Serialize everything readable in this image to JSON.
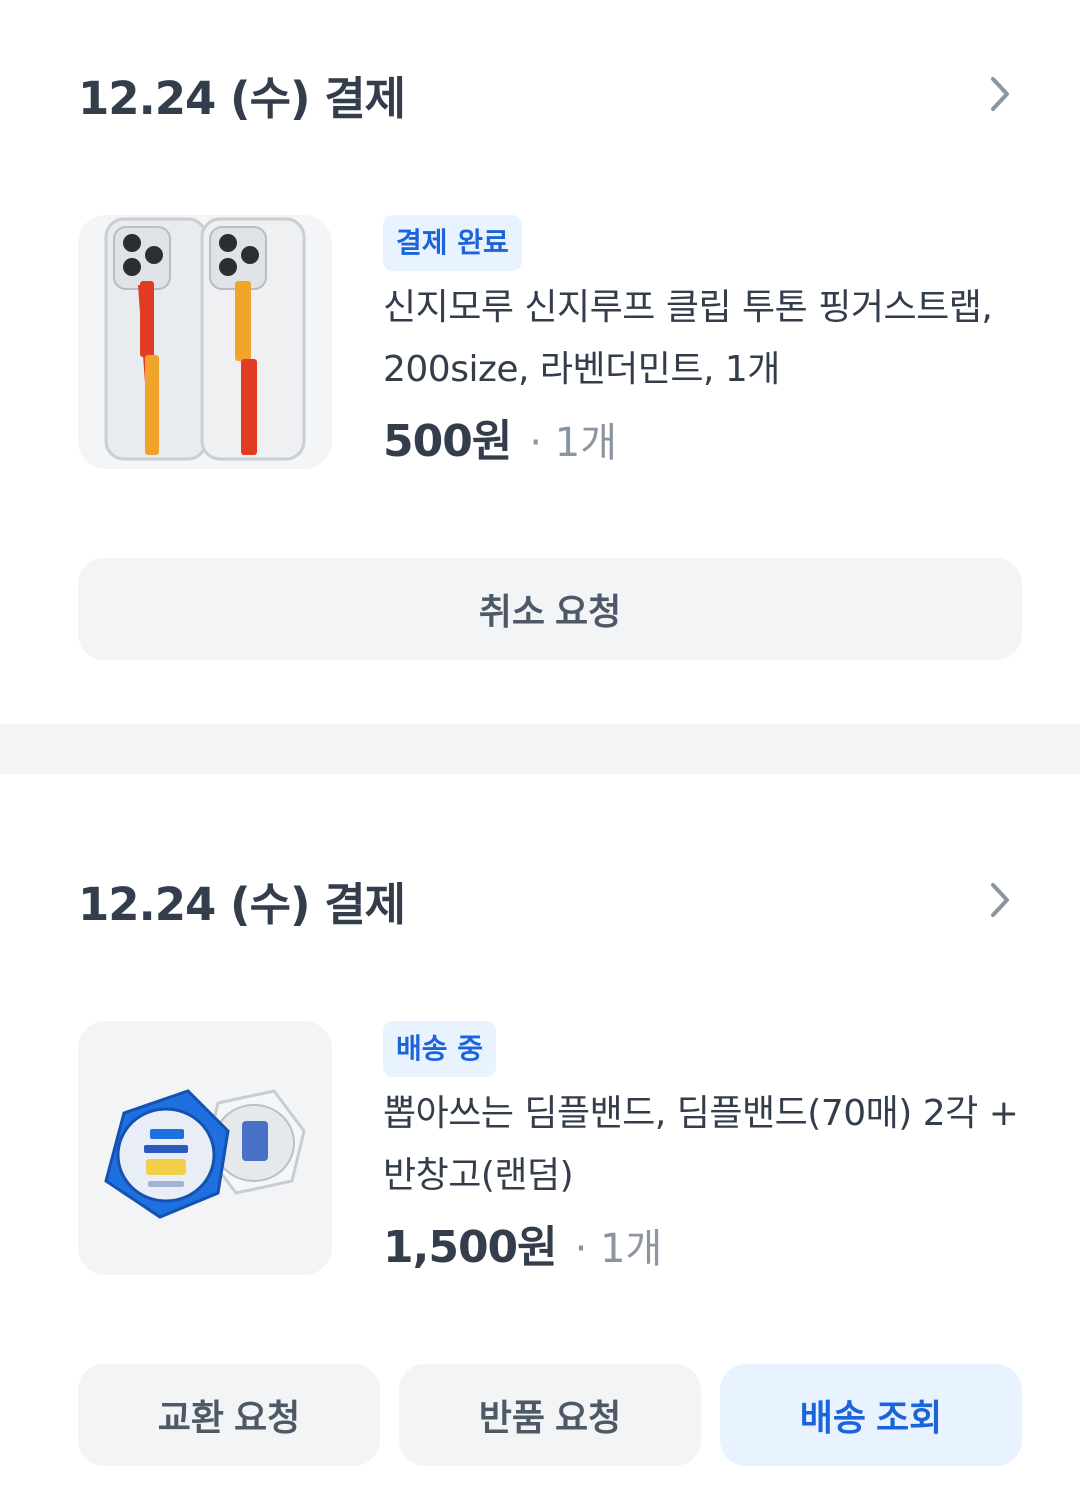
{
  "orders": [
    {
      "date": "12.24 (수) 결제",
      "status": "결제 완료",
      "product_name": "신지모루 신지루프 클립 투톤 핑거스트랩, 200size, 라벤더민트, 1개",
      "price": "500원",
      "quantity": "· 1개",
      "thumbnail": "phone-case-finger-strap-image",
      "buttons": [
        "취소 요청"
      ]
    },
    {
      "date": "12.24 (수) 결제",
      "status": "배송 중",
      "product_name": "뽑아쓰는 딤플밴드, 딤플밴드(70매) 2각 + 반창고(랜덤)",
      "price": "1,500원",
      "quantity": "· 1개",
      "thumbnail": "dimple-band-dispenser-image",
      "buttons": [
        "교환 요청",
        "반품 요청",
        "배송 조회"
      ]
    }
  ],
  "colors": {
    "badge_bg": "#e8f3ff",
    "badge_text": "#1b64da",
    "button_bg": "#f2f4f6",
    "primary_button_bg": "#e8f3ff",
    "primary_button_text": "#1b64da",
    "section_divider": "#f2f4f6"
  }
}
